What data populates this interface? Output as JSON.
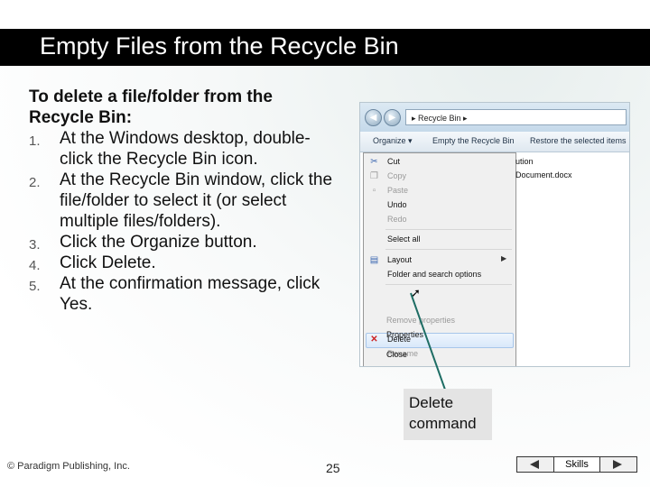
{
  "title": "Empty Files from the Recycle Bin",
  "instructions": {
    "heading": "To delete a file/folder from the Recycle Bin:",
    "steps": [
      {
        "num": "1.",
        "text": "At the Windows desktop, double-click the Recycle Bin icon."
      },
      {
        "num": "2.",
        "text": "At the Recycle Bin window, click the file/folder to select it (or select multiple files/folders)."
      },
      {
        "num": "3.",
        "text": "Click the Organize button."
      },
      {
        "num": "4.",
        "text": "Click Delete."
      },
      {
        "num": "5.",
        "text": "At the confirmation message, click Yes."
      }
    ]
  },
  "screenshot": {
    "breadcrumb": "▸ Recycle Bin ▸",
    "toolbar": {
      "organize": "Organize ▾",
      "empty": "Empty the Recycle Bin",
      "restore": "Restore the selected items"
    },
    "menu": [
      {
        "label": "Cut",
        "enabled": true,
        "icon": "scissors-icon"
      },
      {
        "label": "Copy",
        "enabled": false,
        "icon": "copy-icon"
      },
      {
        "label": "Paste",
        "enabled": false,
        "icon": "paste-icon"
      },
      {
        "label": "Undo",
        "enabled": true,
        "icon": ""
      },
      {
        "label": "Redo",
        "enabled": false,
        "icon": ""
      },
      {
        "label": "Select all",
        "enabled": true,
        "icon": ""
      },
      {
        "label": "Layout",
        "enabled": true,
        "icon": "layout-icon",
        "submenu": true
      },
      {
        "label": "Folder and search options",
        "enabled": true,
        "icon": ""
      },
      {
        "label": "Delete",
        "enabled": true,
        "icon": "delete-x-icon",
        "highlighted": true
      },
      {
        "label": "Rename",
        "enabled": false,
        "icon": ""
      },
      {
        "label": "Remove properties",
        "enabled": false,
        "icon": ""
      },
      {
        "label": "Properties",
        "enabled": true,
        "icon": ""
      },
      {
        "label": "Close",
        "enabled": true,
        "icon": ""
      }
    ],
    "files": [
      "ution",
      "Document.docx"
    ]
  },
  "callout": {
    "line1": "Delete",
    "line2": "command"
  },
  "footer": {
    "copyright": "© Paradigm Publishing, Inc.",
    "page": "25",
    "nav_label": "Skills"
  }
}
